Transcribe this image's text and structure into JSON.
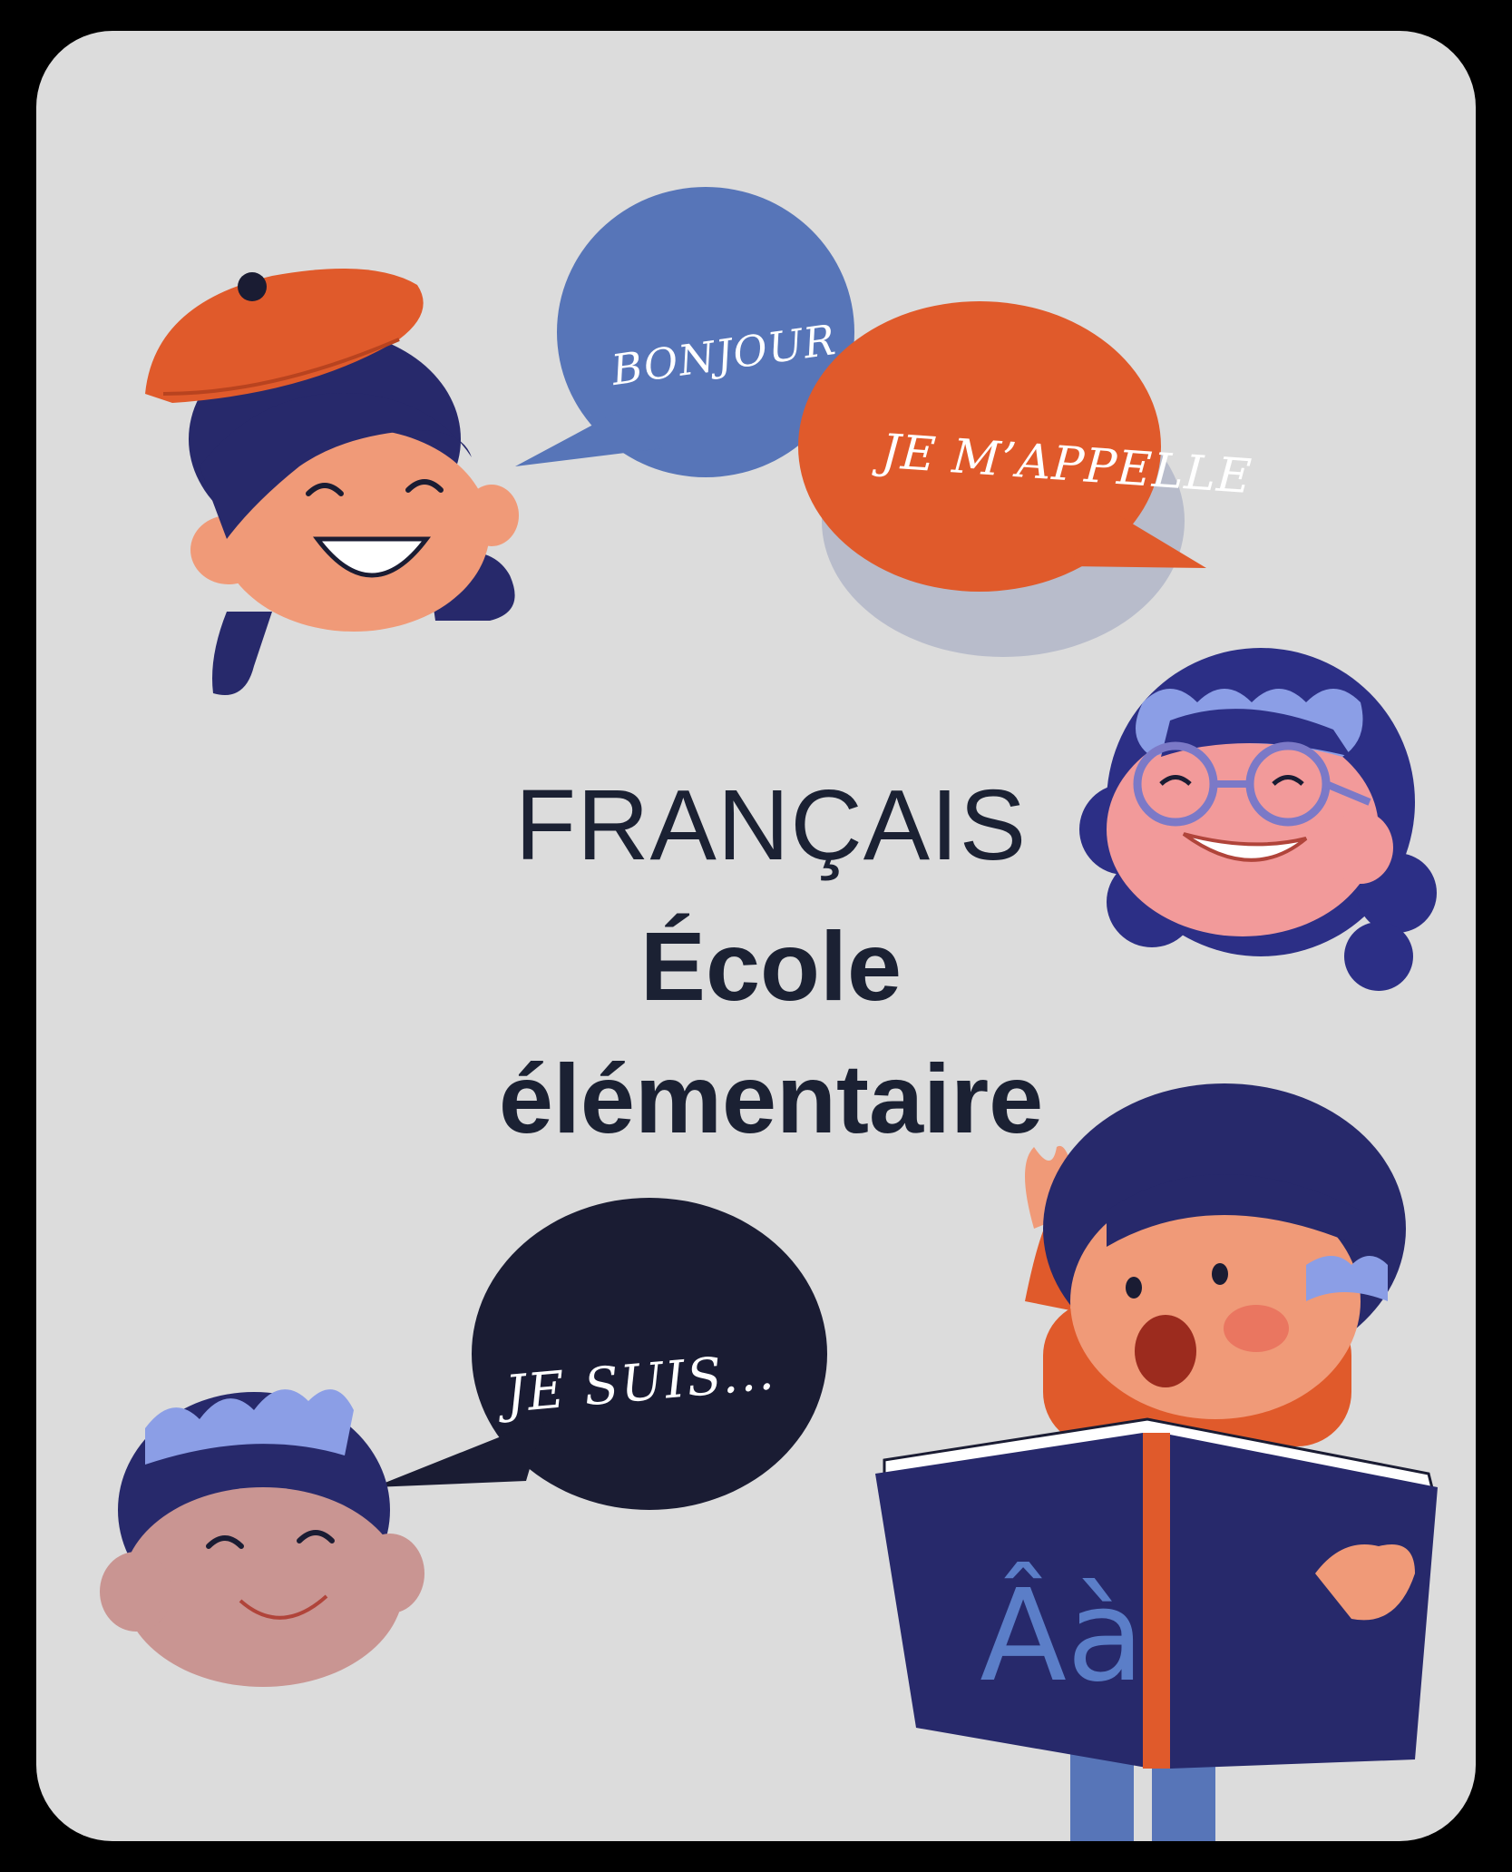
{
  "bubbles": {
    "bonjour": "BONJOUR",
    "appelle": "JE M’APPELLE",
    "suis": "JE SUIS..."
  },
  "title": {
    "line1": "FRANÇAIS",
    "line2": "École",
    "line3": "élémentaire"
  },
  "book": {
    "letters": "Âà"
  },
  "colors": {
    "background": "#dcdcdc",
    "blue_bubble": "#5775b8",
    "orange_bubble": "#e05a2b",
    "dark_bubble": "#1a1c33",
    "hair": "#27296b",
    "text": "#1b2133"
  }
}
